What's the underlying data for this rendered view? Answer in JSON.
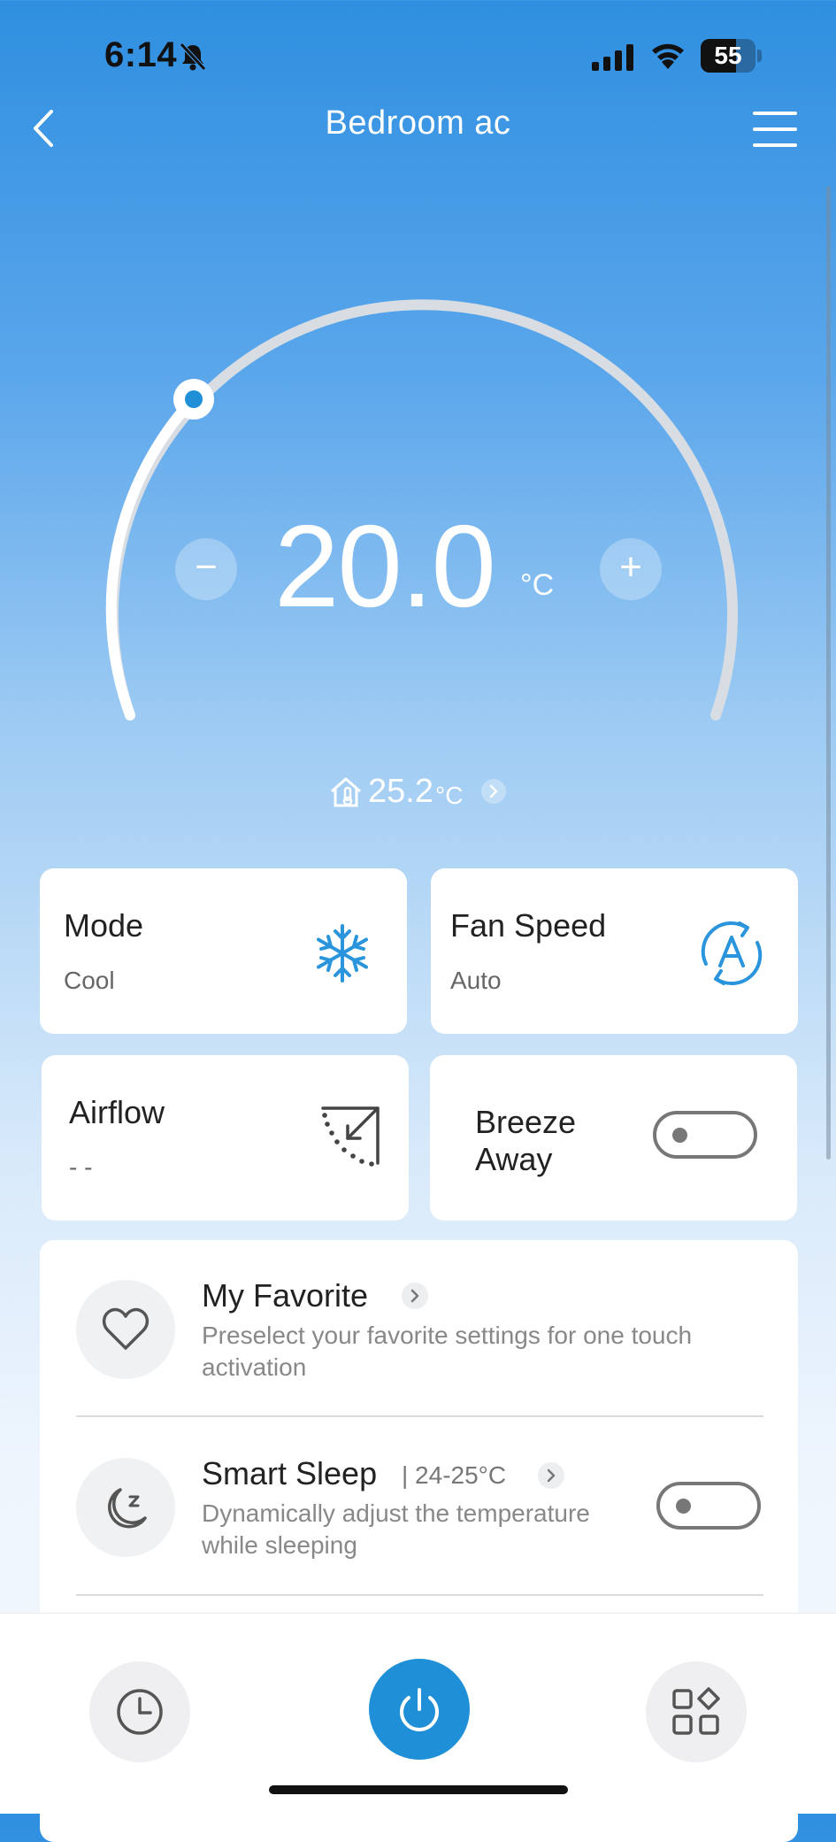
{
  "status_bar": {
    "time": "6:14",
    "battery": "55"
  },
  "header": {
    "title": "Bedroom ac"
  },
  "thermostat": {
    "set_temperature": "20.0",
    "unit": "°C",
    "minus_label": "−",
    "plus_label": "+",
    "indoor_temperature": "25.2",
    "indoor_unit": "°C"
  },
  "cards": {
    "mode": {
      "title": "Mode",
      "value": "Cool"
    },
    "fan_speed": {
      "title": "Fan Speed",
      "value": "Auto"
    },
    "airflow": {
      "title": "Airflow",
      "value": "- -"
    },
    "breeze_away": {
      "title_line1": "Breeze",
      "title_line2": "Away",
      "enabled": false
    }
  },
  "list": {
    "my_favorite": {
      "title": "My Favorite",
      "desc_line1": "Preselect your favorite settings for one touch",
      "desc_line2": "activation"
    },
    "smart_sleep": {
      "title": "Smart Sleep",
      "range": "| 24-25°C",
      "desc_line1": "Dynamically adjust the temperature",
      "desc_line2": "while sleeping",
      "enabled": false
    }
  },
  "colors": {
    "accent": "#1f8fd8",
    "icon_blue": "#2a95dc"
  },
  "icons": {
    "back": "chevron-left-icon",
    "menu": "hamburger-menu-icon",
    "mode": "snowflake-icon",
    "fan": "fan-auto-icon",
    "airflow": "airflow-direction-icon",
    "favorite": "heart-icon",
    "sleep": "moon-sleep-icon",
    "timer": "clock-icon",
    "power": "power-icon",
    "apps": "grid-apps-icon"
  }
}
